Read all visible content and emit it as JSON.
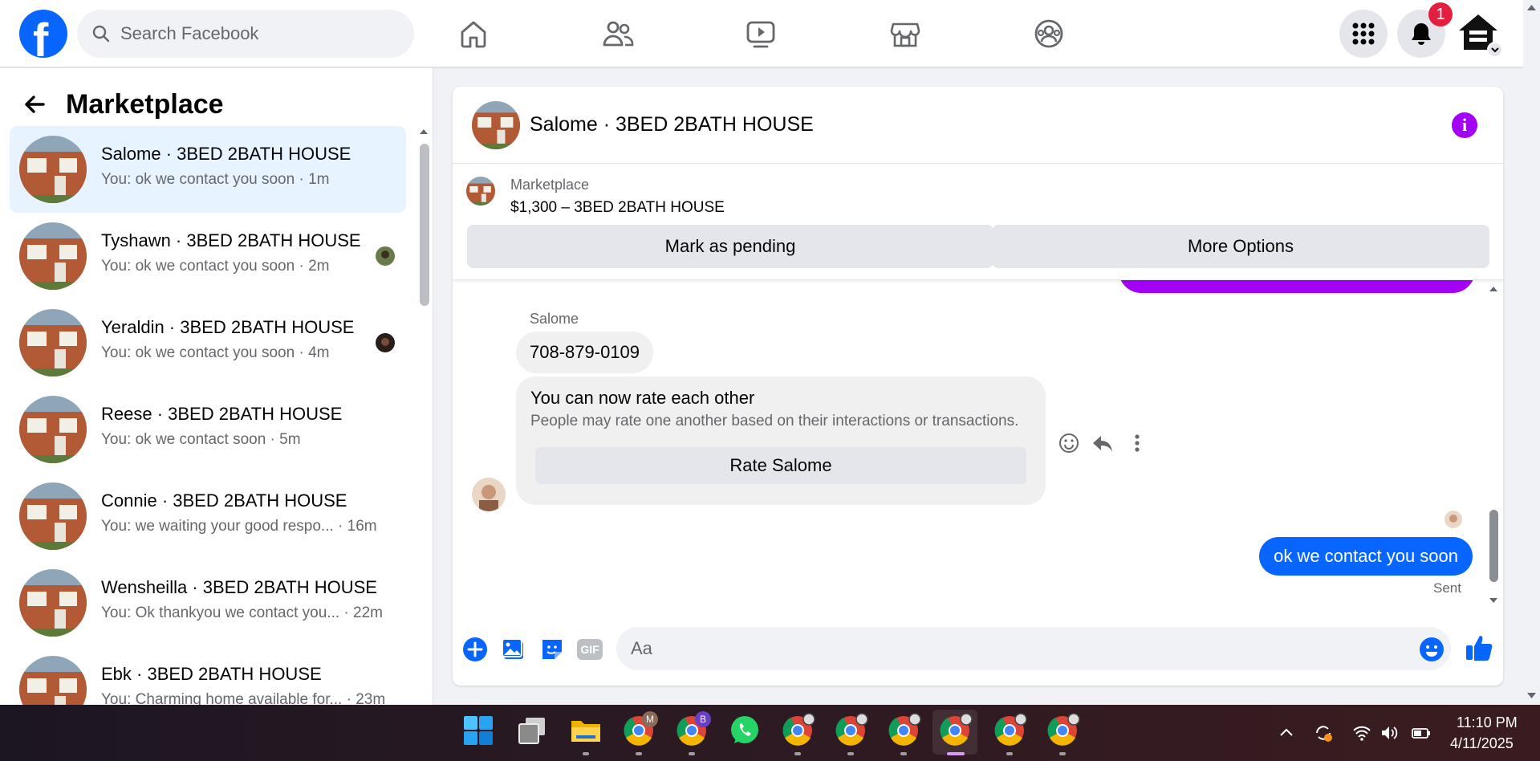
{
  "topbar": {
    "search_placeholder": "Search Facebook",
    "notification_count": "1",
    "icons": [
      "facebook-logo",
      "search-icon",
      "home-icon",
      "friends-icon",
      "video-icon",
      "marketplace-icon",
      "groups-icon",
      "menu-grid-icon",
      "bell-icon",
      "profile-icon"
    ]
  },
  "sidebar": {
    "title": "Marketplace",
    "conversations": [
      {
        "name": "Salome · 3BED 2BATH HOUSE",
        "preview": "You: ok we contact you soon · 1m",
        "active": true
      },
      {
        "name": "Tyshawn · 3BED 2BATH HOUSE",
        "preview": "You: ok we contact you soon · 2m"
      },
      {
        "name": "Yeraldin · 3BED 2BATH HOUSE",
        "preview": "You: ok we contact you soon · 4m"
      },
      {
        "name": "Reese · 3BED 2BATH HOUSE",
        "preview": "You: ok we contact soon · 5m"
      },
      {
        "name": "Connie · 3BED 2BATH HOUSE",
        "preview": "You: we waiting your good respo... · 16m"
      },
      {
        "name": "Wensheilla · 3BED 2BATH HOUSE",
        "preview": "You: Ok thankyou we contact you... · 22m"
      },
      {
        "name": "Ebk · 3BED 2BATH HOUSE",
        "preview": "You: Charming home available for... · 23m"
      }
    ]
  },
  "chat": {
    "title": "Salome · 3BED 2BATH HOUSE",
    "listing_label": "Marketplace",
    "listing_price": "$1,300 – 3BED 2BATH HOUSE",
    "mark_pending": "Mark as pending",
    "more_options": "More Options",
    "sender_name": "Salome",
    "received_message": "708-879-0109",
    "rate_title": "You can now rate each other",
    "rate_desc": "People may rate one another based on their interactions or transactions.",
    "rate_button": "Rate Salome",
    "sent_message": "ok we contact you soon",
    "sent_status": "Sent",
    "composer_placeholder": "Aa",
    "gif_label": "GIF"
  },
  "taskbar": {
    "time": "11:10 PM",
    "date": "4/11/2025",
    "badge_m": "M",
    "badge_b": "B"
  },
  "colors": {
    "facebook_blue": "#0866ff",
    "accent_purple": "#a400f5",
    "active_row": "#e7f3ff",
    "notification_red": "#e41e3f"
  }
}
